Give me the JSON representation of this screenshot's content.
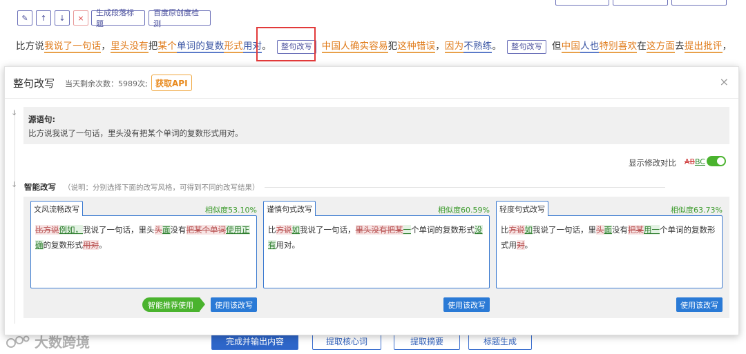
{
  "toolbar": {
    "edit_icon": "✎",
    "up_icon": "↑",
    "down_icon": "↓",
    "close_icon": "×",
    "gen_title_label": "生成段落标题",
    "baidu_label": "百度原创度检测"
  },
  "sentence": {
    "s1": "比方说",
    "s2": "我说了",
    "s3": "一句话",
    "s4": "，",
    "s5": "里头",
    "s6": "没有",
    "s7": "把",
    "s8": "某个",
    "s9": "单词的复数",
    "s10": "形式",
    "s11": "用对",
    "s12": "。",
    "rewrite_btn_1": "整句改写",
    "s13": "中国人",
    "s14": "确实",
    "s15": "容易",
    "s16": "犯",
    "s17": "这种错误",
    "s18": "，",
    "s19": "因为",
    "s20": "不熟练",
    "s21": "。",
    "rewrite_btn_2": "整句改写",
    "s22": "但",
    "s23": "中国",
    "s24": "人也",
    "s25": "特别喜欢",
    "s26": "在",
    "s27": "这方面",
    "s28": "去",
    "s29": "提出批评",
    "s30": "，"
  },
  "modal": {
    "title": "整句改写",
    "remaining": "当天剩余次数：5989次;",
    "api_button": "获取API",
    "close_icon": "×",
    "source_label": "源语句:",
    "source_text": "比方说我说了一句话，里头没有把某个单词的复数形式用对。",
    "diff_label": "显示修改对比",
    "diff_ab": "AB",
    "diff_bc": "BC",
    "diff_enabled": true,
    "smart_label": "智能改写",
    "smart_desc": "（说明：分别选择下面的改写风格，可得到不同的改写结果）",
    "timeline_arrow": "↓",
    "cards": [
      {
        "tab": "文风流畅改写",
        "similarity": "相似度53.10%",
        "use_label": "使用该改写",
        "seg": [
          "比方说",
          "例如，",
          "我说了一句话，里头",
          "",
          "没有",
          "把某个单词",
          "",
          "使用正确",
          "的复数形式",
          "用对",
          "。"
        ]
      },
      {
        "tab": "谨慎句式改写",
        "similarity": "相似度60.59%",
        "use_label": "使用该改写",
        "seg": [
          "比",
          "方说",
          "如",
          "我说了一句话，",
          "里头没有把某",
          "一",
          "个单词的复数形式",
          "没有",
          "用",
          "对。"
        ]
      },
      {
        "tab": "轻度句式改写",
        "similarity": "相似度63.73%",
        "use_label": "使用该改写",
        "seg": [
          "比",
          "方说",
          "如",
          "我说了一句话，里",
          "头",
          "面",
          "没有",
          "把某",
          "用一",
          "个单词的复数形式用",
          "对",
          "。"
        ]
      }
    ],
    "recommend_badge": "智能推荐使用"
  },
  "bottom": {
    "finish_btn": "完成并输出内容",
    "keyword_btn": "提取核心词",
    "summary_btn": "提取摘要",
    "title_btn": "标题生成"
  },
  "watermark": {
    "text": "大数跨境"
  },
  "colors": {
    "primary_blue": "#2e66c9",
    "accent_orange": "#e07b1a",
    "highlight_red": "#e23a3a",
    "success_green": "#4ab32e"
  }
}
